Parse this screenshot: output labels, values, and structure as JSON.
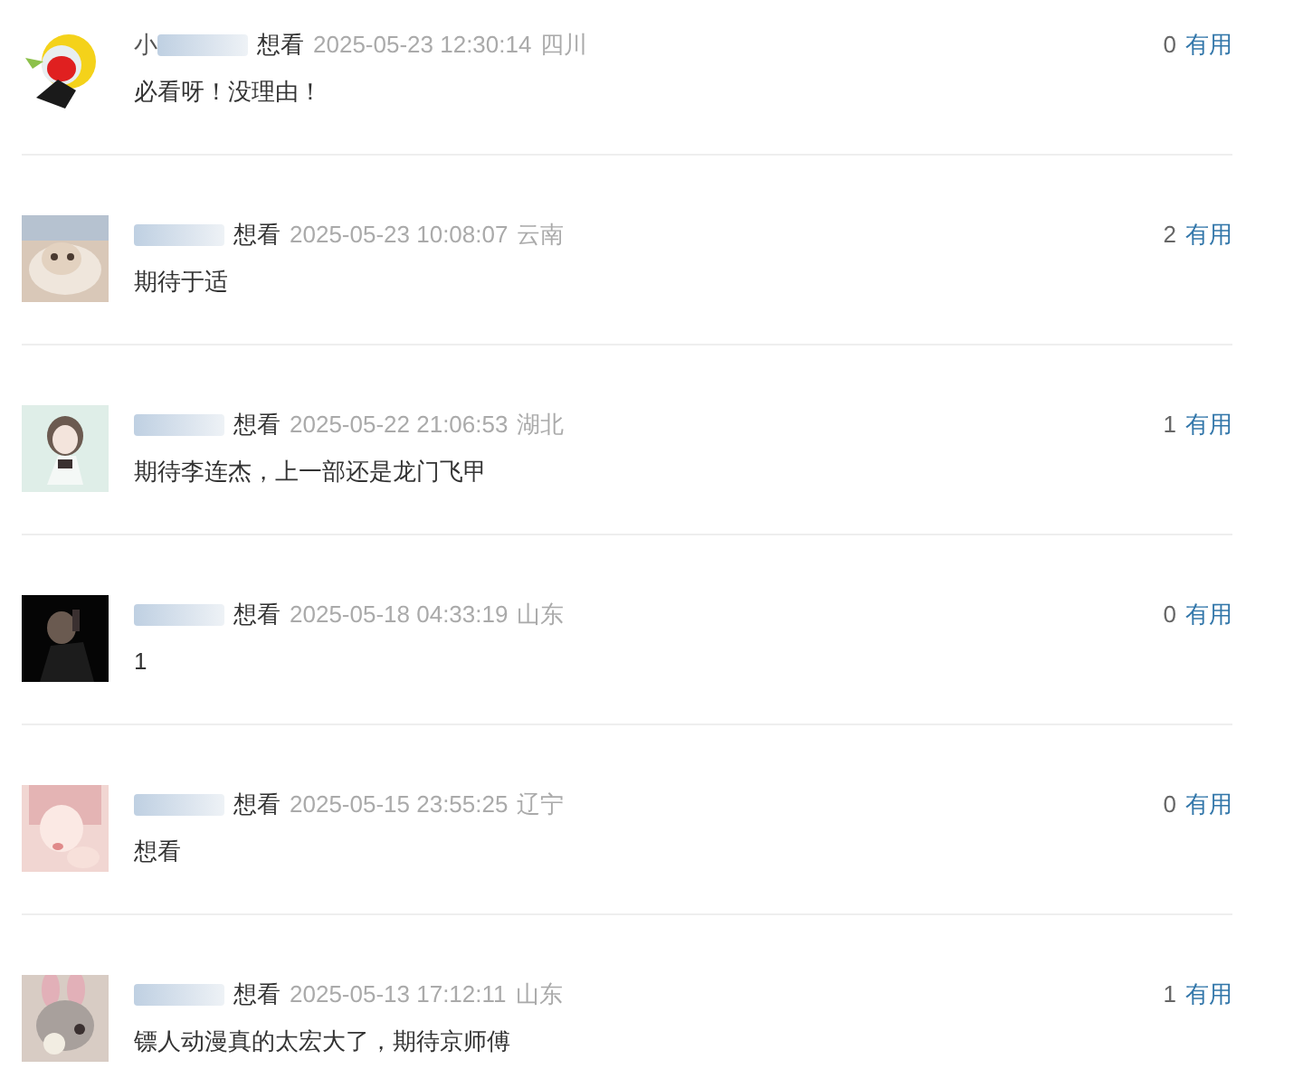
{
  "comments": [
    {
      "name": "小",
      "tag": "想看",
      "time": "2025-05-23 12:30:14",
      "region": "四川",
      "text": "必看呀！没理由！",
      "count": "0",
      "useful": "有用"
    },
    {
      "tag": "想看",
      "time": "2025-05-23 10:08:07",
      "region": "云南",
      "text": "期待于适",
      "count": "2",
      "useful": "有用"
    },
    {
      "tag": "想看",
      "time": "2025-05-22 21:06:53",
      "region": "湖北",
      "text": "期待李连杰，上一部还是龙门飞甲",
      "count": "1",
      "useful": "有用"
    },
    {
      "tag": "想看",
      "time": "2025-05-18 04:33:19",
      "region": "山东",
      "text": "1",
      "count": "0",
      "useful": "有用"
    },
    {
      "tag": "想看",
      "time": "2025-05-15 23:55:25",
      "region": "辽宁",
      "text": "想看",
      "count": "0",
      "useful": "有用"
    },
    {
      "tag": "想看",
      "time": "2025-05-13 17:12:11",
      "region": "山东",
      "text": "镖人动漫真的太宏大了，期待京师傅",
      "count": "1",
      "useful": "有用"
    }
  ]
}
